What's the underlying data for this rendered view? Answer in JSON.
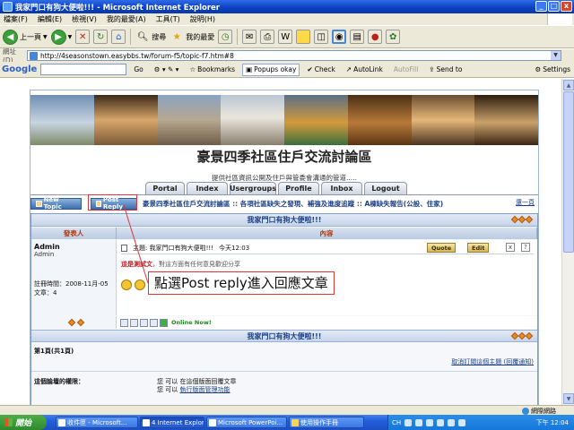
{
  "window": {
    "title": "我家門口有狗大便啦!!! - Microsoft Internet Explorer",
    "btn_min": "_",
    "btn_max": "□",
    "btn_close": "x"
  },
  "menu": [
    "檔案(F)",
    "編輯(E)",
    "檢視(V)",
    "我的最愛(A)",
    "工具(T)",
    "說明(H)"
  ],
  "toolbar": {
    "back": "上一頁",
    "search": "搜尋",
    "favorites": "我的最愛"
  },
  "address": {
    "label": "網址(D)",
    "url": "http://4seasonstown.easybbs.tw/forum-f5/topic-f7.htm#8"
  },
  "google_bar": {
    "logo": "Google",
    "go": "Go",
    "bookmarks": "Bookmarks",
    "popups": "Popups okay",
    "check": "Check",
    "autolink": "AutoLink",
    "autofill": "AutoFill",
    "sendto": "Send to",
    "settings": "Settings"
  },
  "forum": {
    "title": "豪景四季社區住戶交流討論區",
    "subtitle": "提供社區資訊公開及住戶與管委會溝通的管道.....",
    "tabs": [
      "Portal",
      "Index",
      "Usergroups",
      "Profile",
      "Inbox",
      "Logout"
    ],
    "new_topic": "New Topic",
    "post_reply": "Post Reply",
    "breadcrumb": [
      "豪景四季社區住戶交流討論區",
      "各項社區缺失之發現、補強及進度追蹤",
      "A棟缺失報告(公設、住家)"
    ],
    "crumb_sep": "::",
    "next_page": "還一頁",
    "topic_title": "我家門口有狗大便啦!!!",
    "col_author": "發表人",
    "col_content": "內容",
    "post": {
      "author": "Admin",
      "rank": "Admin",
      "subject": "主題: 我家門口有狗大便啦!!!",
      "time": "今天12:03",
      "reg_date": "註冊時間：2008-11月-05",
      "posts": "文章：4",
      "quote": "Quote",
      "edit": "Edit",
      "delete": "x",
      "ip": "?",
      "text_red": "這是測試文",
      "text_rest": "，對這方面有任何意見歡迎分享",
      "online": "Online Now!"
    },
    "page_info": "第1頁(共1頁)",
    "watch_link": "取消訂閱這個主題 (回覆通知)",
    "perm_heading": "這個論壇的權限：",
    "perm_line1": "您 可以 在這個版面回覆文章",
    "perm_line2_prefix": "您 可以 ",
    "perm_line2_link": "執行版面管理功能"
  },
  "annotation": "點選Post reply進入回應文章",
  "status": {
    "zone": "網際網路"
  },
  "taskbar": {
    "start": "開始",
    "items": [
      "收件匣 - Microsoft...",
      "4 Internet Explorer",
      "Microsoft PowerPoi...",
      "使用操作手冊"
    ],
    "lang": "CH",
    "clock": "下午 12:04"
  }
}
